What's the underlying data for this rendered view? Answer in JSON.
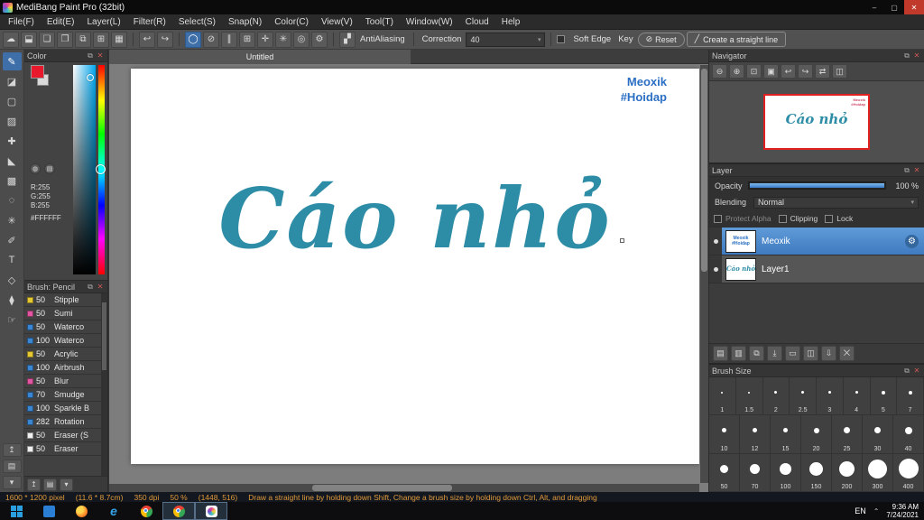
{
  "colors": {
    "accent_blue": "#3a7bc8",
    "selected_layer": "#4a86c8",
    "canvas_lettering": "#2d8ca6",
    "watermark_blue": "#2b6fc4",
    "status_text": "#e09a3a",
    "navigator_border": "#e02020"
  },
  "ui": {
    "caret": "▾"
  },
  "panel_chrome": {
    "popout": "⧉",
    "close": "✕"
  },
  "titlebar": {
    "title": "MediBang Paint Pro (32bit)",
    "minimize_glyph": "–",
    "maximize_glyph": "▢",
    "close_glyph": "✕"
  },
  "menubar": {
    "items": [
      "File(F)",
      "Edit(E)",
      "Layer(L)",
      "Filter(R)",
      "Select(S)",
      "Snap(N)",
      "Color(C)",
      "View(V)",
      "Tool(T)",
      "Window(W)",
      "Cloud",
      "Help"
    ]
  },
  "toolbar": {
    "file_icons": [
      {
        "name": "cloud-icon",
        "glyph": "☁"
      },
      {
        "name": "save-icon",
        "glyph": "⬓"
      },
      {
        "name": "comment-icon",
        "glyph": "❏"
      },
      {
        "name": "chat-icon",
        "glyph": "❐"
      },
      {
        "name": "copy-icon",
        "glyph": "⧉"
      },
      {
        "name": "grid-icon",
        "glyph": "⊞"
      },
      {
        "name": "material-icon",
        "glyph": "▦"
      }
    ],
    "history_icons": [
      {
        "name": "undo-icon",
        "glyph": "↩"
      },
      {
        "name": "redo-icon",
        "glyph": "↪"
      }
    ],
    "snap_icons": [
      {
        "name": "brush-tip-icon",
        "glyph": "◯",
        "active": true
      },
      {
        "name": "snap-off-icon",
        "glyph": "⊘"
      },
      {
        "name": "snap-parallel-icon",
        "glyph": "∥"
      },
      {
        "name": "snap-grid-icon",
        "glyph": "⊞"
      },
      {
        "name": "snap-cross-icon",
        "glyph": "✛"
      },
      {
        "name": "snap-radial-icon",
        "glyph": "✳"
      },
      {
        "name": "snap-circle-icon",
        "glyph": "◎"
      },
      {
        "name": "snap-settings-icon",
        "glyph": "⚙"
      }
    ],
    "aa_icon_glyph": "▞",
    "antialiasing_label": "AntiAliasing",
    "correction_label": "Correction",
    "correction_value": "40",
    "soft_edge_label": "Soft Edge",
    "key_label": "Key",
    "reset_icon_glyph": "⊘",
    "reset_label": "Reset",
    "straight_line_icon_glyph": "╱",
    "straight_line_label": "Create a straight line"
  },
  "tool_strip": [
    {
      "name": "brush-tool",
      "glyph": "✎",
      "active": true
    },
    {
      "name": "eraser-tool",
      "glyph": "◪"
    },
    {
      "name": "marquee-select-tool",
      "glyph": "▢"
    },
    {
      "name": "stamp-tool",
      "glyph": "▨"
    },
    {
      "name": "move-tool",
      "glyph": "✚"
    },
    {
      "name": "bucket-fill-tool",
      "glyph": "◣"
    },
    {
      "name": "gradient-tool",
      "glyph": "▩"
    },
    {
      "name": "lasso-select-tool",
      "glyph": "◌"
    },
    {
      "name": "magic-wand-tool",
      "glyph": "✳"
    },
    {
      "name": "select-pen-tool",
      "glyph": "✐"
    },
    {
      "name": "text-tool",
      "glyph": "T"
    },
    {
      "name": "shape-tool",
      "glyph": "◇"
    },
    {
      "name": "eyedropper-tool",
      "glyph": "⧫"
    },
    {
      "name": "hand-tool",
      "glyph": "☞"
    }
  ],
  "tool_strip_footer": [
    {
      "name": "collapse-panel-icon",
      "glyph": "↥"
    },
    {
      "name": "palette-icon",
      "glyph": "▤"
    },
    {
      "name": "strip-menu-icon",
      "glyph": "▾"
    }
  ],
  "color_panel": {
    "title": "Color",
    "wheel_icon": "◍",
    "palette_icon": "▤",
    "r": "R:255",
    "g": "G:255",
    "b": "B:255",
    "hex": "#FFFFFF"
  },
  "brush_panel": {
    "title": "Brush: Pencil",
    "brushes": [
      {
        "size": "50",
        "name": "Stipple",
        "chip": "#e6c832"
      },
      {
        "size": "50",
        "name": "Sumi",
        "chip": "#e255a0"
      },
      {
        "size": "50",
        "name": "Waterco",
        "chip": "#3a86d2"
      },
      {
        "size": "100",
        "name": "Waterco",
        "chip": "#3a86d2"
      },
      {
        "size": "50",
        "name": "Acrylic",
        "chip": "#e6c832"
      },
      {
        "size": "100",
        "name": "Airbrush",
        "chip": "#3a86d2"
      },
      {
        "size": "50",
        "name": "Blur",
        "chip": "#e255a0"
      },
      {
        "size": "70",
        "name": "Smudge",
        "chip": "#3a86d2"
      },
      {
        "size": "100",
        "name": "Sparkle B",
        "chip": "#3a86d2"
      },
      {
        "size": "282",
        "name": "Rotation",
        "chip": "#3a86d2"
      },
      {
        "size": "50",
        "name": "Eraser (S",
        "chip": "#f0f0f0"
      },
      {
        "size": "50",
        "name": "Eraser",
        "chip": "#f0f0f0"
      }
    ]
  },
  "canvas": {
    "tab": "Untitled",
    "watermark_line1": "Meoxik",
    "watermark_line2": "#Hoidap",
    "lettering": "Cáo nhỏ"
  },
  "navigator": {
    "title": "Navigator",
    "icons": [
      {
        "name": "zoom-out-icon",
        "glyph": "⊖"
      },
      {
        "name": "zoom-in-icon",
        "glyph": "⊕"
      },
      {
        "name": "fit-window-icon",
        "glyph": "⊡"
      },
      {
        "name": "actual-size-icon",
        "glyph": "▣"
      },
      {
        "name": "rotate-left-icon",
        "glyph": "↩"
      },
      {
        "name": "rotate-right-icon",
        "glyph": "↪"
      },
      {
        "name": "reset-rotation-icon",
        "glyph": "⇄"
      },
      {
        "name": "flip-icon",
        "glyph": "◫"
      }
    ]
  },
  "layer_panel": {
    "title": "Layer",
    "opacity_label": "Opacity",
    "opacity_value": "100 %",
    "blending_label": "Blending",
    "blending_value": "Normal",
    "protect_alpha_label": "Protect Alpha",
    "clipping_label": "Clipping",
    "lock_label": "Lock",
    "gear_glyph": "⚙",
    "layers": [
      {
        "name": "Meoxik",
        "selected": true,
        "thumb_line1": "Meoxik",
        "thumb_line2": "#Hoidap",
        "thumb_color": "#2b6fc4",
        "thumb_style": "sans"
      },
      {
        "name": "Layer1",
        "selected": false,
        "thumb_line1": "Cáo nhỏ",
        "thumb_line2": "",
        "thumb_color": "#2d8ca6",
        "thumb_style": "serif"
      }
    ],
    "footer_icons": [
      {
        "name": "new-layer-icon",
        "glyph": "▤"
      },
      {
        "name": "new-folder-icon",
        "glyph": "▥"
      },
      {
        "name": "duplicate-layer-icon",
        "glyph": "⧉"
      },
      {
        "name": "transfer-layer-icon",
        "glyph": "⤓"
      },
      {
        "name": "folder-icon",
        "glyph": "▭"
      },
      {
        "name": "clipping-icon",
        "glyph": "◫"
      },
      {
        "name": "merge-layer-icon",
        "glyph": "⇩"
      },
      {
        "name": "delete-layer-icon",
        "glyph": "⨉"
      }
    ]
  },
  "brush_size_panel": {
    "title": "Brush Size",
    "rows": [
      [
        1,
        1.5,
        2,
        2.5,
        3,
        4,
        5,
        7
      ],
      [
        10,
        12,
        15,
        20,
        25,
        30,
        40
      ],
      [
        50,
        70,
        100,
        150,
        200,
        300,
        400
      ]
    ]
  },
  "statusbar": {
    "dimensions": "1600 * 1200 pixel",
    "size_cm": "(11.6 * 8.7cm)",
    "dpi": "350 dpi",
    "zoom": "50 %",
    "coords": "(1448, 516)",
    "hint": "Draw a straight line by holding down Shift, Change a brush size by holding down Ctrl, Alt, and dragging"
  },
  "taskbar": {
    "icons": [
      {
        "name": "start-button",
        "type": "win"
      },
      {
        "name": "mail-icon",
        "type": "blue"
      },
      {
        "name": "firefox-icon",
        "type": "firefox"
      },
      {
        "name": "edge-icon",
        "type": "ie"
      },
      {
        "name": "chrome-icon",
        "type": "chrome"
      },
      {
        "name": "chrome-window-icon",
        "type": "chrome",
        "active": true
      },
      {
        "name": "medibang-window-icon",
        "type": "medibang",
        "active": true
      }
    ],
    "lang": "EN",
    "caret": "⌃",
    "time": "9:36 AM",
    "date": "7/24/2021"
  }
}
